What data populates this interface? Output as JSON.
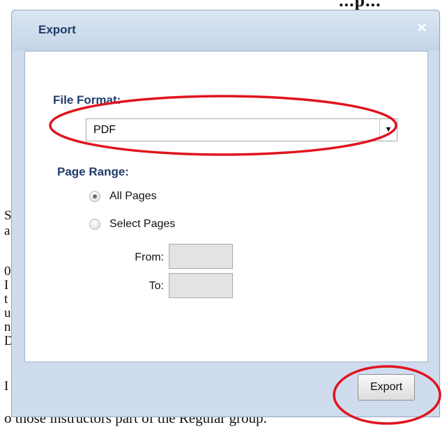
{
  "background": {
    "top_fragment": "...p...",
    "left_fragments": [
      "S",
      "a",
      "0",
      "I",
      "t",
      "u",
      "n",
      "D",
      "I"
    ],
    "bottom_fragment": "o those instructors part of the Regular group."
  },
  "dialog": {
    "title": "Export",
    "close_glyph": "×",
    "file_format": {
      "label": "File Format:",
      "selected": "PDF",
      "arrow_glyph": "▼"
    },
    "page_range": {
      "label": "Page Range:",
      "options": [
        {
          "label": "All Pages",
          "checked": true
        },
        {
          "label": "Select Pages",
          "checked": false
        }
      ],
      "from_label": "From:",
      "to_label": "To:",
      "from_value": "",
      "to_value": ""
    },
    "export_button": "Export"
  },
  "colors": {
    "annotation": "#e0141e",
    "title_text": "#1f3b66",
    "dialog_frame": "#cfdced"
  }
}
